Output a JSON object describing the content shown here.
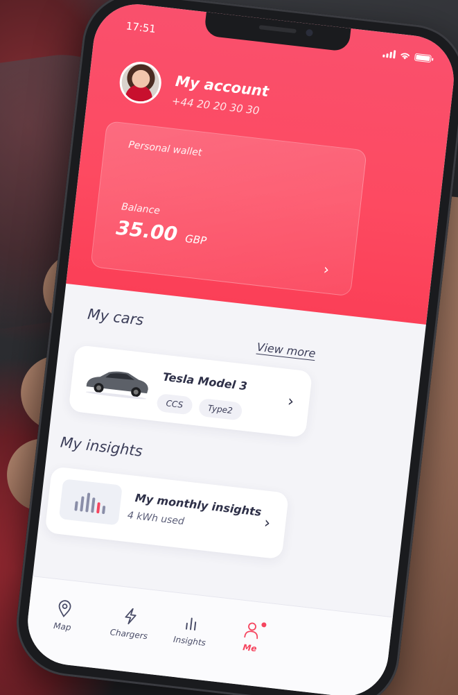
{
  "status_bar": {
    "time": "17:51"
  },
  "account": {
    "title": "My account",
    "phone": "+44 20 20 30 30"
  },
  "wallet": {
    "label": "Personal wallet",
    "balance_label": "Balance",
    "amount": "35.00",
    "currency": "GBP"
  },
  "cars": {
    "title": "My cars",
    "view_more": "View more",
    "items": [
      {
        "name": "Tesla Model 3",
        "connectors": [
          "CCS",
          "Type2"
        ]
      }
    ]
  },
  "insights": {
    "title": "My insights",
    "card_title": "My monthly insights",
    "card_subtitle": "4 kWh used"
  },
  "tabbar": {
    "items": [
      {
        "label": "Map",
        "icon": "map-pin-icon"
      },
      {
        "label": "Chargers",
        "icon": "lightning-icon"
      },
      {
        "label": "Insights",
        "icon": "bar-chart-icon"
      },
      {
        "label": "Me",
        "icon": "user-icon",
        "active": true
      }
    ]
  },
  "colors": {
    "accent": "#f5455f",
    "header": "#fb4a62",
    "text_dark": "#2e3048"
  }
}
